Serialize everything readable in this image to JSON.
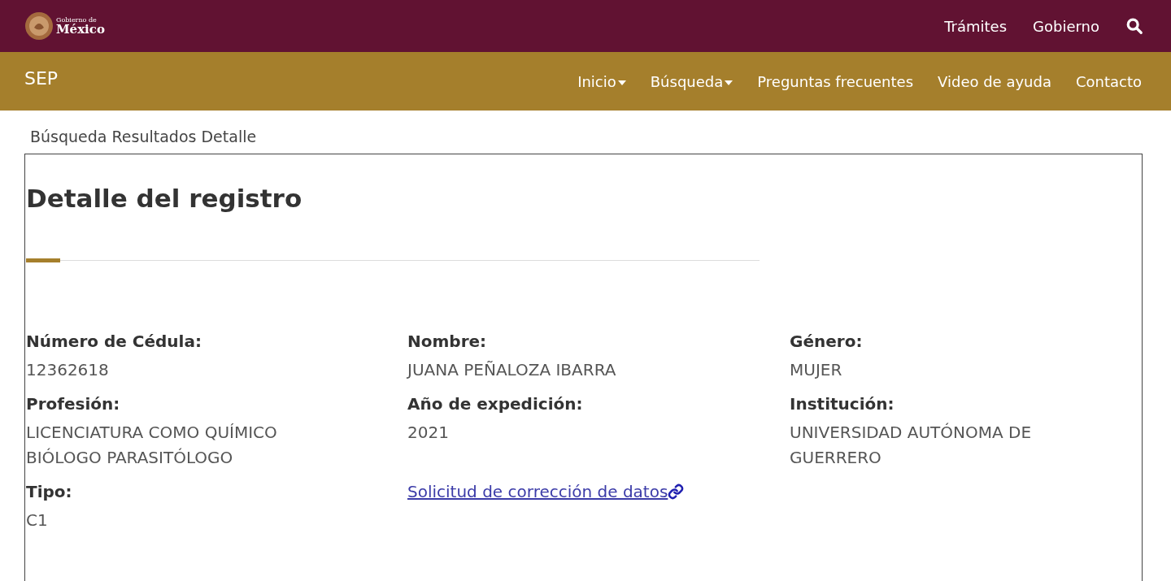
{
  "header": {
    "logo_small": "Gobierno de",
    "logo_large": "México",
    "links": [
      "Trámites",
      "Gobierno"
    ]
  },
  "subnav": {
    "title": "SEP",
    "items": [
      {
        "label": "Inicio",
        "dropdown": true
      },
      {
        "label": "Búsqueda",
        "dropdown": true
      },
      {
        "label": "Preguntas frecuentes",
        "dropdown": false
      },
      {
        "label": "Video de ayuda",
        "dropdown": false
      },
      {
        "label": "Contacto",
        "dropdown": false
      }
    ]
  },
  "breadcrumb": "Búsqueda Resultados Detalle",
  "card": {
    "title": "Detalle del registro",
    "fields": [
      {
        "kind": "field",
        "label": "Número de Cédula:",
        "value": "12362618"
      },
      {
        "kind": "field",
        "label": "Nombre:",
        "value": "JUANA PEÑALOZA IBARRA"
      },
      {
        "kind": "field",
        "label": "Género:",
        "value": "MUJER"
      },
      {
        "kind": "field",
        "label": "Profesión:",
        "value": "LICENCIATURA COMO QUÍMICO BIÓLOGO PARASITÓLOGO"
      },
      {
        "kind": "field",
        "label": "Año de expedición:",
        "value": "2021"
      },
      {
        "kind": "field",
        "label": "Institución:",
        "value": "UNIVERSIDAD AUTÓNOMA DE GUERRERO"
      },
      {
        "kind": "field",
        "label": "Tipo:",
        "value": "C1"
      },
      {
        "kind": "link",
        "label": "Solicitud de corrección de datos"
      }
    ]
  }
}
